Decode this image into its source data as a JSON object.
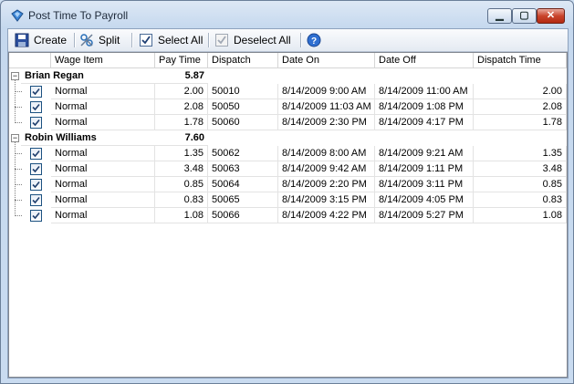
{
  "window": {
    "title": "Post Time To Payroll"
  },
  "toolbar": {
    "create": "Create",
    "split": "Split",
    "select_all": "Select All",
    "deselect_all": "Deselect All"
  },
  "columns": [
    "Wage Item",
    "Pay Time",
    "Dispatch",
    "Date On",
    "Date Off",
    "Dispatch Time"
  ],
  "groups": [
    {
      "name": "Brian Regan",
      "total": "5.87",
      "rows": [
        {
          "checked": true,
          "wage": "Normal",
          "pay": "2.00",
          "dispatch": "50010",
          "on": "8/14/2009 9:00 AM",
          "off": "8/14/2009 11:00 AM",
          "dtime": "2.00"
        },
        {
          "checked": true,
          "wage": "Normal",
          "pay": "2.08",
          "dispatch": "50050",
          "on": "8/14/2009 11:03 AM",
          "off": "8/14/2009 1:08 PM",
          "dtime": "2.08"
        },
        {
          "checked": true,
          "wage": "Normal",
          "pay": "1.78",
          "dispatch": "50060",
          "on": "8/14/2009 2:30 PM",
          "off": "8/14/2009 4:17 PM",
          "dtime": "1.78"
        }
      ]
    },
    {
      "name": "Robin Williams",
      "total": "7.60",
      "rows": [
        {
          "checked": true,
          "wage": "Normal",
          "pay": "1.35",
          "dispatch": "50062",
          "on": "8/14/2009 8:00 AM",
          "off": "8/14/2009 9:21 AM",
          "dtime": "1.35"
        },
        {
          "checked": true,
          "wage": "Normal",
          "pay": "3.48",
          "dispatch": "50063",
          "on": "8/14/2009 9:42 AM",
          "off": "8/14/2009 1:11 PM",
          "dtime": "3.48"
        },
        {
          "checked": true,
          "wage": "Normal",
          "pay": "0.85",
          "dispatch": "50064",
          "on": "8/14/2009 2:20 PM",
          "off": "8/14/2009 3:11 PM",
          "dtime": "0.85"
        },
        {
          "checked": true,
          "wage": "Normal",
          "pay": "0.83",
          "dispatch": "50065",
          "on": "8/14/2009 3:15 PM",
          "off": "8/14/2009 4:05 PM",
          "dtime": "0.83"
        },
        {
          "checked": true,
          "wage": "Normal",
          "pay": "1.08",
          "dispatch": "50066",
          "on": "8/14/2009 4:22 PM",
          "off": "8/14/2009 5:27 PM",
          "dtime": "1.08"
        }
      ]
    }
  ]
}
